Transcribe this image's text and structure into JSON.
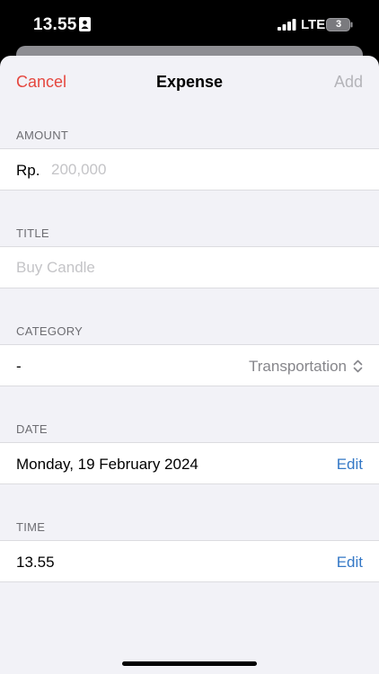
{
  "status_bar": {
    "time": "13.55",
    "network": "LTE",
    "battery_level": "3"
  },
  "nav": {
    "cancel_label": "Cancel",
    "title": "Expense",
    "add_label": "Add"
  },
  "amount": {
    "header": "AMOUNT",
    "currency": "Rp.",
    "placeholder": "200,000"
  },
  "title_field": {
    "header": "TITLE",
    "placeholder": "Buy Candle"
  },
  "category": {
    "header": "CATEGORY",
    "left_value": "-",
    "selected": "Transportation",
    "icon": "chevron-up-down-icon"
  },
  "date": {
    "header": "DATE",
    "value": "Monday, 19 February 2024",
    "edit_label": "Edit"
  },
  "time_field": {
    "header": "TIME",
    "value": "13.55",
    "edit_label": "Edit"
  },
  "colors": {
    "cancel": "#e5473f",
    "link": "#3478c6",
    "disabled": "#b4b4b9",
    "background": "#f2f2f7"
  }
}
